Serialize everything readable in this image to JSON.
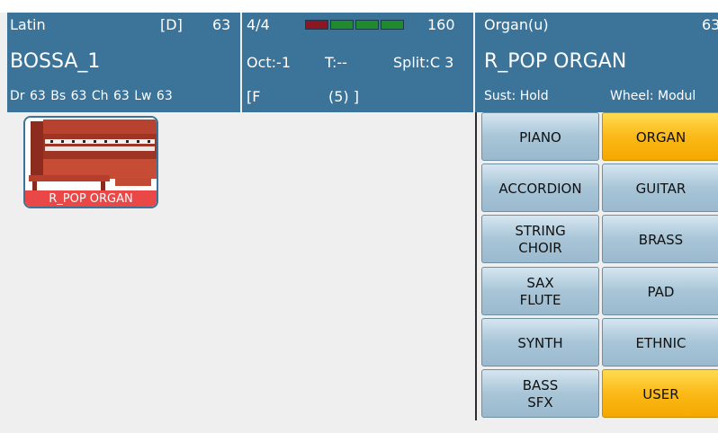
{
  "style_panel": {
    "category": "Latin",
    "variation": "[D]",
    "tempo_value": "63",
    "name": "BOSSA_1",
    "levels": "Dr 63   Bs 63  Ch 63  Lw 63"
  },
  "info_panel": {
    "time_signature": "4/4",
    "tempo": "160",
    "octave": "Oct:-1",
    "transpose": "T:--",
    "split": "Split:C 3",
    "chord_open": "[F",
    "chord_value": "(5) ]",
    "meter_colors": [
      "#8b1726",
      "#1f8a2e",
      "#1f8a2e",
      "#1f8a2e"
    ]
  },
  "voice_panel": {
    "bank": "Organ(u)",
    "volume": "63",
    "name": "R_POP ORGAN",
    "sustain": "Sust: Hold",
    "wheel": "Wheel: Modul"
  },
  "voice_list": [
    {
      "label": "R_POP ORGAN",
      "icon": "organ-image"
    }
  ],
  "categories": [
    {
      "id": "piano",
      "label": "PIANO",
      "active": false
    },
    {
      "id": "organ",
      "label": "ORGAN",
      "active": true
    },
    {
      "id": "accordion",
      "label": "ACCORDION",
      "active": false
    },
    {
      "id": "guitar",
      "label": "GUITAR",
      "active": false
    },
    {
      "id": "string-choir",
      "label": "STRING\nCHOIR",
      "active": false
    },
    {
      "id": "brass",
      "label": "BRASS",
      "active": false
    },
    {
      "id": "sax-flute",
      "label": "SAX\nFLUTE",
      "active": false
    },
    {
      "id": "pad",
      "label": "PAD",
      "active": false
    },
    {
      "id": "synth",
      "label": "SYNTH",
      "active": false
    },
    {
      "id": "ethnic",
      "label": "ETHNIC",
      "active": false
    },
    {
      "id": "bass-sfx",
      "label": "BASS\nSFX",
      "active": false
    },
    {
      "id": "user",
      "label": "USER",
      "active": true
    }
  ],
  "colors": {
    "header": "#3c7399",
    "active_button": "#fbb917",
    "button": "#a9c6d8",
    "thumb_label": "#e94847"
  }
}
